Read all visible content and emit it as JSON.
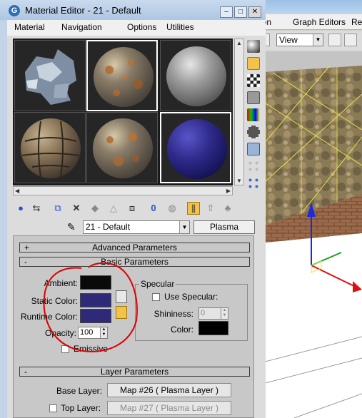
{
  "window": {
    "title": "Material Editor - 21 - Default",
    "icon_letter": "G"
  },
  "menu": [
    "Material",
    "Navigation",
    "Options",
    "Utilities"
  ],
  "background_app": {
    "menu": [
      "ition",
      "Graph Editors",
      "Re"
    ],
    "view_dropdown": "View"
  },
  "material_name": "21 - Default",
  "material_type": "Plasma Standard",
  "rollouts": {
    "advanced": {
      "sign": "+",
      "title": "Advanced Parameters"
    },
    "basic": {
      "sign": "-",
      "title": "Basic Parameters"
    },
    "layer": {
      "sign": "-",
      "title": "Layer Parameters"
    }
  },
  "basic_params": {
    "ambient_label": "Ambient:",
    "static_label": "Static Color:",
    "runtime_label": "Runtime Color:",
    "opacity_label": "Opacity:",
    "opacity_value": "100",
    "emissive_label": "Emissive",
    "specular_group": "Specular",
    "use_specular_label": "Use Specular:",
    "shininess_label": "Shininess:",
    "shininess_value": "0",
    "color_label": "Color:"
  },
  "layer_params": {
    "base_label": "Base Layer:",
    "base_map": "Map #26  ( Plasma Layer )",
    "top_label": "Top Layer:",
    "top_map": "Map #27  ( Plasma Layer )"
  },
  "colors": {
    "ambient": "#0a0a0a",
    "static": "#2e2a78",
    "runtime": "#2e2a78",
    "specular": "#000000",
    "annotation": "#e00000"
  },
  "slots": [
    {
      "name": "rock-chunk",
      "active": false
    },
    {
      "name": "rusty-metal",
      "active": true
    },
    {
      "name": "grey-marble",
      "active": false
    },
    {
      "name": "stone-tiles",
      "active": false
    },
    {
      "name": "rusty-metal-2",
      "active": false
    },
    {
      "name": "blue-plasma",
      "active": true
    }
  ]
}
